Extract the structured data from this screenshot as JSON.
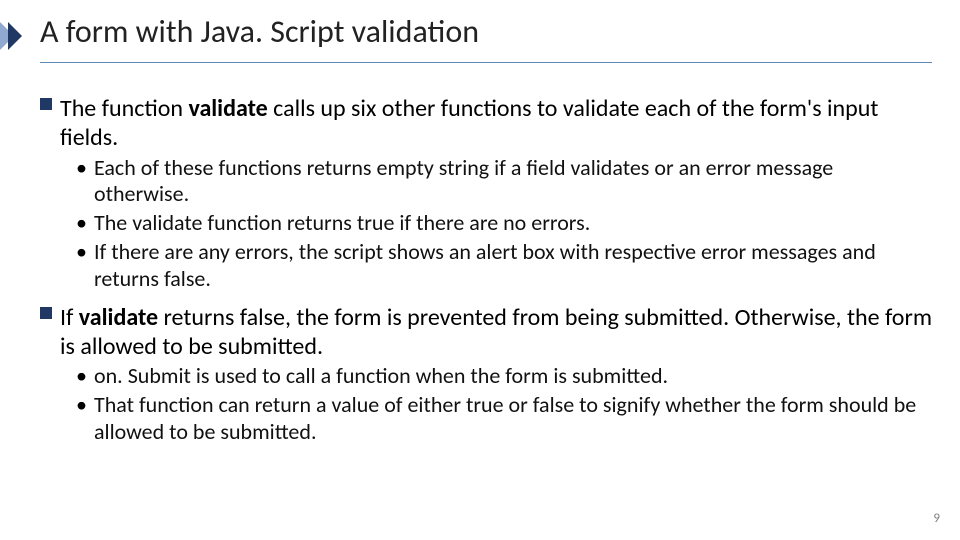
{
  "title": "A form with Java. Script validation",
  "bullets": {
    "b1_pre": "The function ",
    "b1_bold": "validate",
    "b1_post": " calls up six other functions to validate each of the form's input fields.",
    "b1s1": "Each of these functions returns empty string if a field validates or an error message otherwise.",
    "b1s2": "The validate function returns true if there are no errors.",
    "b1s3": "If there are any errors, the script shows an alert box with respective error messages and returns false.",
    "b2_pre": "If ",
    "b2_bold": "validate",
    "b2_post": " returns false, the form is prevented from being submitted. Otherwise, the form is allowed to be submitted.",
    "b2s1": "on. Submit is used to call a function when the form is submitted.",
    "b2s2": "That function can return a value of either true or false to signify whether the form should be allowed to be submitted."
  },
  "page_number": "9",
  "colors": {
    "chevron_dark": "#1f3864",
    "chevron_light": "#8fa9d0",
    "rule": "#5b88b5"
  }
}
